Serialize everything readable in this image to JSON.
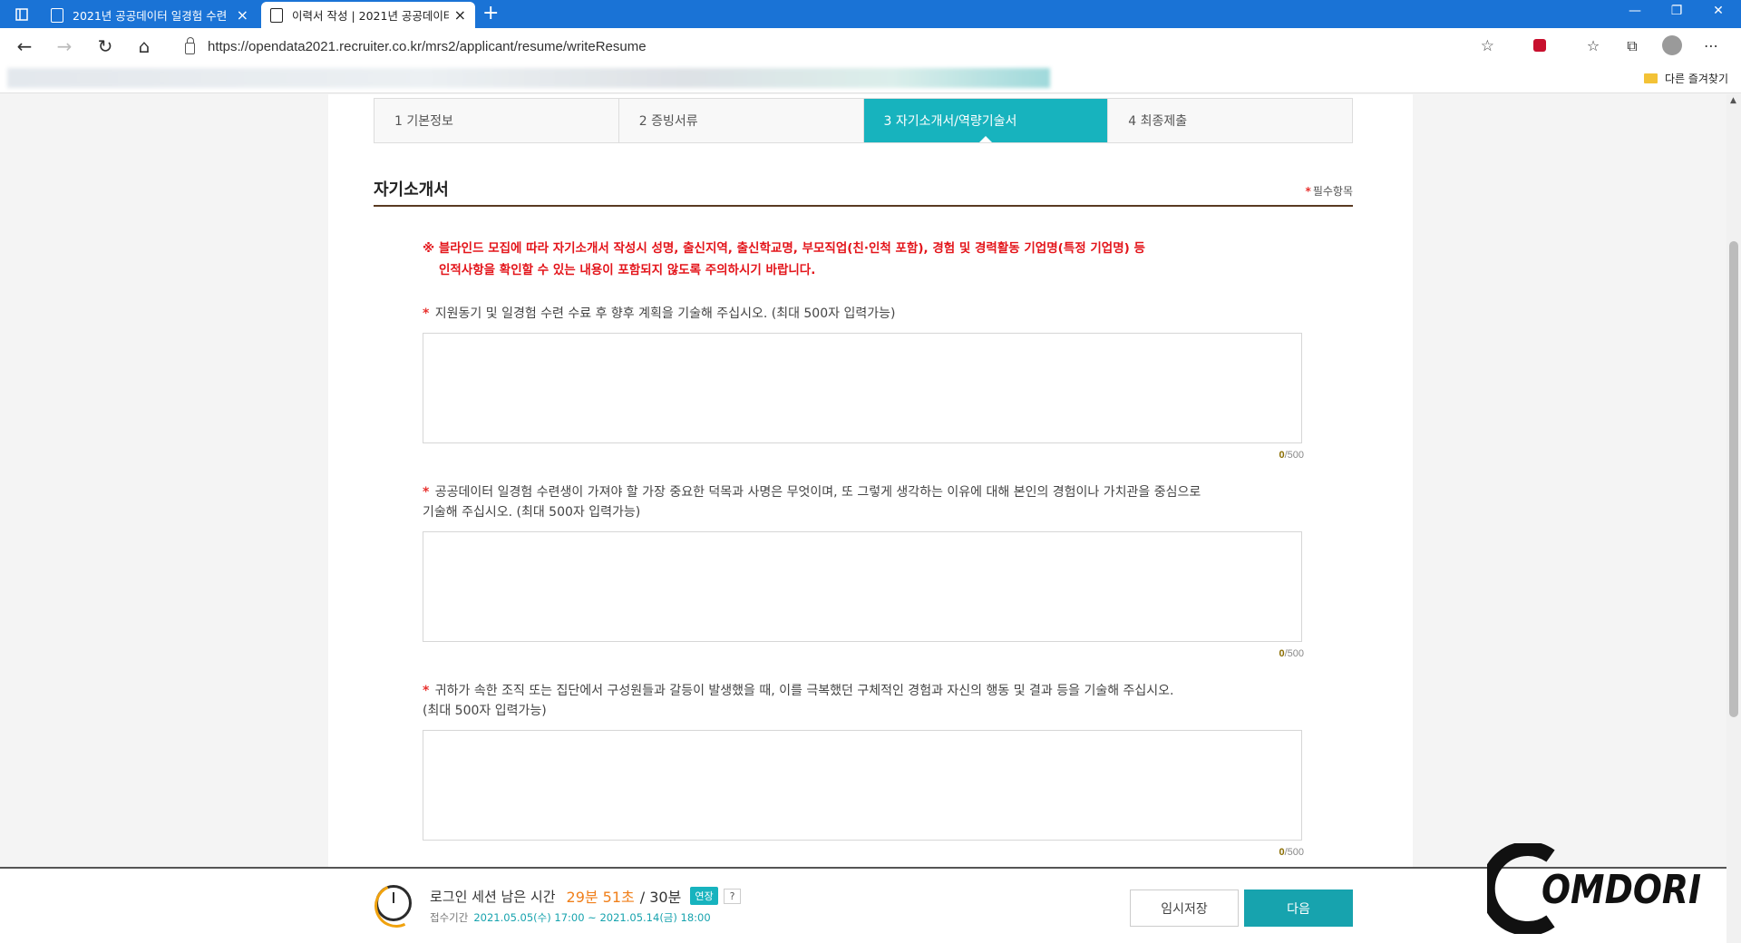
{
  "browser": {
    "tabs": [
      {
        "title": "2021년 공공데이터 일경험 수련",
        "active": false
      },
      {
        "title": "이력서 작성 | 2021년 공공데이터",
        "active": true
      }
    ],
    "url": "https://opendata2021.recruiter.co.kr/mrs2/applicant/resume/writeResume",
    "bookmarks_other": "다른 즐겨찾기"
  },
  "steps": [
    {
      "label": "1  기본정보",
      "active": false
    },
    {
      "label": "2  증빙서류",
      "active": false
    },
    {
      "label": "3  자기소개서/역량기술서",
      "active": true
    },
    {
      "label": "4  최종제출",
      "active": false
    }
  ],
  "section": {
    "title": "자기소개서",
    "required_mark": "*",
    "required_label": "필수항목"
  },
  "warning": {
    "line1": "※ 블라인드 모집에 따라 자기소개서 작성시 성명, 출신지역, 출신학교명, 부모직업(친·인척 포함), 경험 및 경력활동 기업명(특정 기업명) 등",
    "line2": "인적사항을 확인할 수 있는 내용이 포함되지 않도록 주의하시기 바랍니다."
  },
  "questions": [
    {
      "star": "*",
      "text": "지원동기 및 일경험 수련 수료 후 향후 계획을 기술해 주십시오. (최대 500자 입력가능)",
      "text2": "",
      "value": "",
      "count": "0",
      "max": "/500"
    },
    {
      "star": "*",
      "text": "공공데이터 일경험 수련생이 가져야 할 가장 중요한 덕목과 사명은 무엇이며, 또 그렇게 생각하는 이유에 대해 본인의 경험이나 가치관을 중심으로",
      "text2": "기술해 주십시오. (최대 500자 입력가능)",
      "value": "",
      "count": "0",
      "max": "/500"
    },
    {
      "star": "*",
      "text": "귀하가 속한 조직 또는 집단에서 구성원들과 갈등이 발생했을 때, 이를 극복했던 구체적인 경험과 자신의 행동 및 결과 등을 기술해 주십시오.",
      "text2": "(최대 500자 입력가능)",
      "value": "",
      "count": "0",
      "max": "/500"
    }
  ],
  "footer": {
    "session_label": "로그인 세션 남은 시간",
    "remaining": "29분 51초",
    "total": "/ 30분",
    "extend": "연장",
    "help": "?",
    "period_label": "접수기간",
    "period_dates": "2021.05.05(수) 17:00 ~ 2021.05.14(금) 18:00",
    "temp_save": "임시저장",
    "next": "다음"
  },
  "watermark": "COMDORI",
  "colors": {
    "accent": "#17b3be",
    "warning": "#e3141a",
    "remaining": "#f07f1a",
    "tabbar": "#1a73d6"
  }
}
